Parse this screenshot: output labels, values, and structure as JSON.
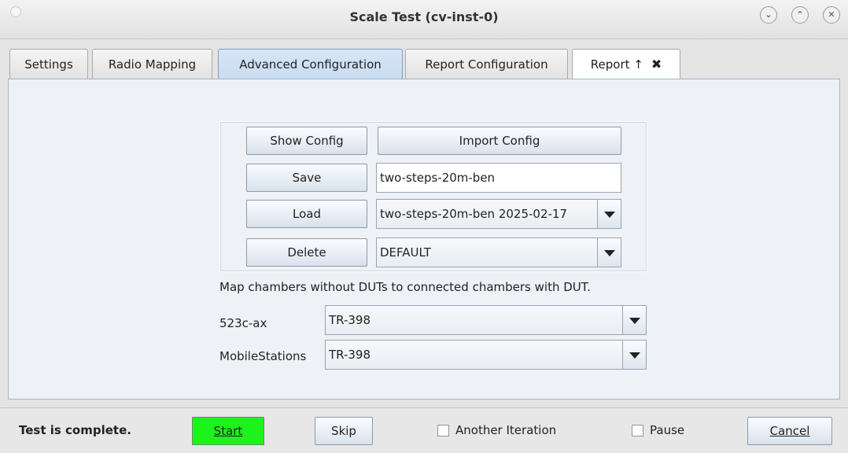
{
  "window": {
    "title": "Scale Test  (cv-inst-0)",
    "controls": [
      "⌄",
      "⌃",
      "✕"
    ]
  },
  "tabs": [
    {
      "label": "Settings"
    },
    {
      "label": "Radio Mapping"
    },
    {
      "label": "Advanced Configuration",
      "active": true
    },
    {
      "label": "Report Configuration"
    },
    {
      "label": "Report ↑",
      "closable": true
    }
  ],
  "config": {
    "show_config_label": "Show Config",
    "import_config_label": "Import Config",
    "save_label": "Save",
    "save_name_value": "two-steps-20m-ben",
    "load_label": "Load",
    "load_value": "two-steps-20m-ben 2025-02-17",
    "delete_label": "Delete",
    "delete_value": "DEFAULT"
  },
  "mapping": {
    "description": "Map chambers without DUTs to connected chambers with DUT.",
    "rows": [
      {
        "label": "523c-ax",
        "value": "TR-398"
      },
      {
        "label": "MobileStations",
        "value": "TR-398"
      }
    ]
  },
  "footer": {
    "status": "Test is complete.",
    "start_label": "Start",
    "skip_label": "Skip",
    "another_iteration_label": "Another Iteration",
    "pause_label": "Pause",
    "cancel_label": "Cancel",
    "start_color": "#1cf21c"
  }
}
